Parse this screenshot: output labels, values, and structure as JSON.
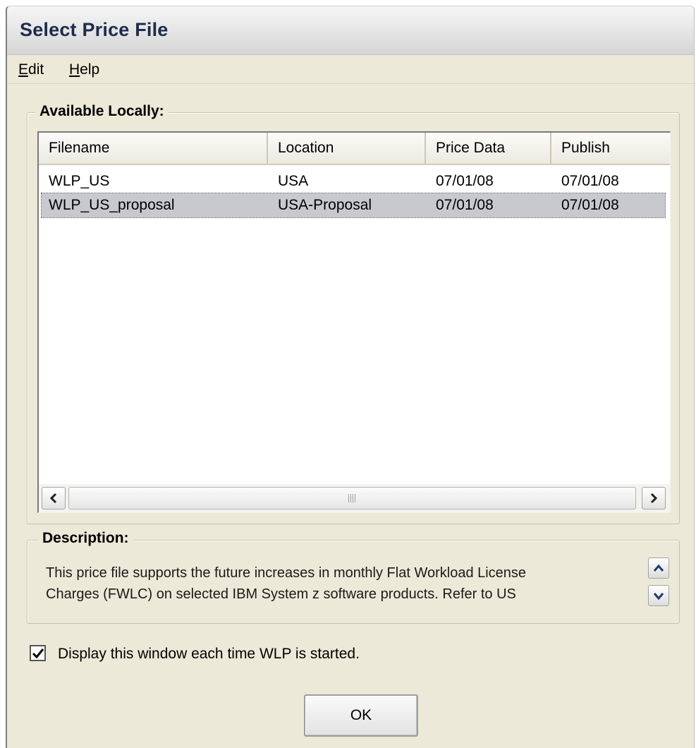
{
  "window": {
    "title": "Select Price File"
  },
  "menubar": {
    "edit": {
      "mnemonic": "E",
      "rest": "dit"
    },
    "help": {
      "mnemonic": "H",
      "rest": "elp"
    }
  },
  "available": {
    "label": "Available Locally:",
    "columns": [
      "Filename",
      "Location",
      "Price Data",
      "Publish"
    ],
    "rows": [
      {
        "filename": "WLP_US",
        "location": "USA",
        "price_data": "07/01/08",
        "publish": "07/01/08",
        "selected": false
      },
      {
        "filename": "WLP_US_proposal",
        "location": "USA-Proposal",
        "price_data": "07/01/08",
        "publish": "07/01/08",
        "selected": true
      }
    ]
  },
  "description": {
    "label": "Description:",
    "line1": "This price file supports the future increases in monthly Flat Workload License",
    "line2": "Charges (FWLC) on selected IBM System z software products.  Refer to US"
  },
  "startup_option": {
    "label": "Display this window each time WLP is started.",
    "checked": true
  },
  "buttons": {
    "ok": "OK"
  },
  "icons": {
    "scroll_left": "chevron-left-icon",
    "scroll_right": "chevron-right-icon",
    "scroll_up": "chevron-up-icon",
    "scroll_down": "chevron-down-icon",
    "check": "checkmark-icon"
  }
}
